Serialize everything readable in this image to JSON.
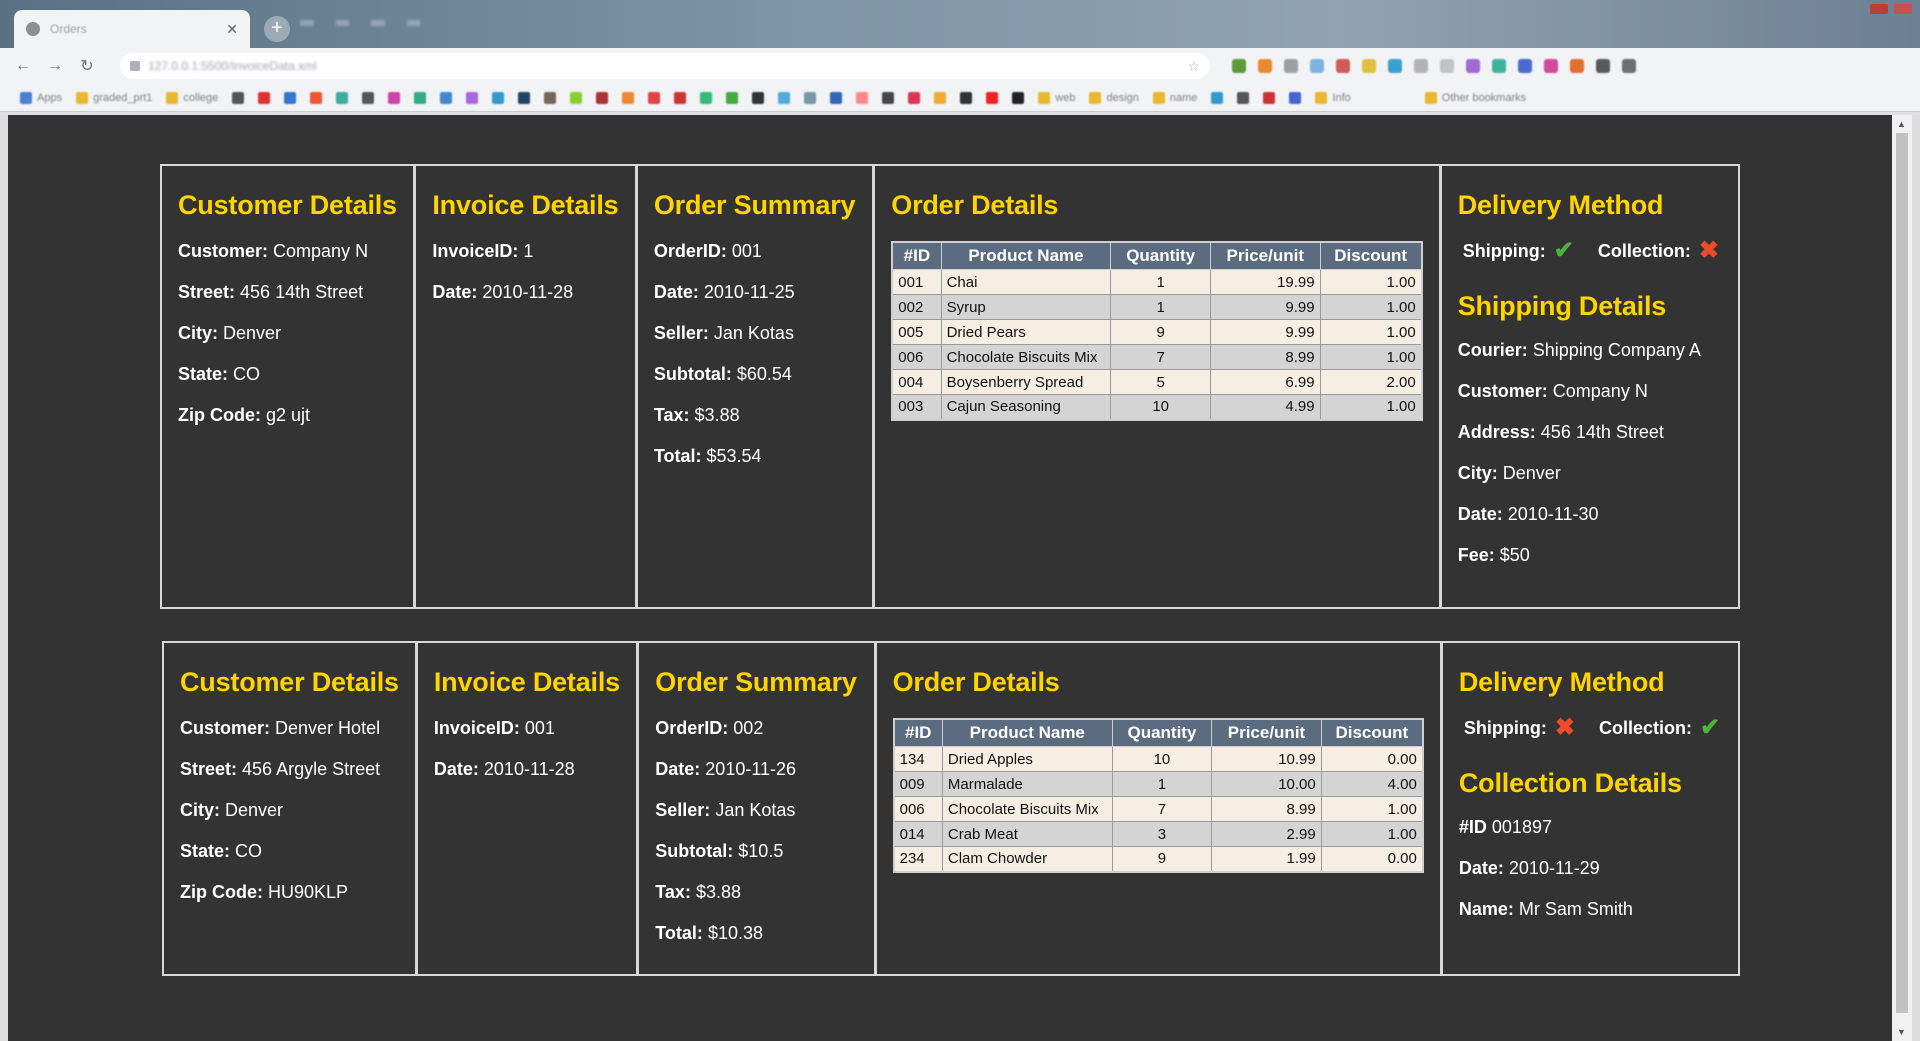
{
  "browser": {
    "tab_title": "Orders",
    "url": "127.0.0.1:5500/InvoiceData.xml",
    "bookmarks": [
      "Apps",
      "graded_prt1",
      "college",
      "web",
      "design",
      "name",
      "Info",
      "Other bookmarks"
    ]
  },
  "orders": [
    {
      "customer": {
        "title": "Customer Details",
        "customer_label": "Customer:",
        "customer": "Company N",
        "street_label": "Street:",
        "street": "456 14th Street",
        "city_label": "City:",
        "city": "Denver",
        "state_label": "State:",
        "state": "CO",
        "zip_label": "Zip Code:",
        "zip": "g2 ujt"
      },
      "invoice": {
        "title": "Invoice Details",
        "id_label": "InvoiceID:",
        "id": "1",
        "date_label": "Date:",
        "date": "2010-11-28"
      },
      "summary": {
        "title": "Order Summary",
        "order_label": "OrderID:",
        "order": "001",
        "date_label": "Date:",
        "date": "2010-11-25",
        "seller_label": "Seller:",
        "seller": "Jan Kotas",
        "subtotal_label": "Subtotal:",
        "subtotal": "$60.54",
        "tax_label": "Tax:",
        "tax": "$3.88",
        "total_label": "Total:",
        "total": "$53.54"
      },
      "details": {
        "title": "Order Details",
        "columns": [
          "#ID",
          "Product Name",
          "Quantity",
          "Price/unit",
          "Discount"
        ],
        "rows": [
          [
            "001",
            "Chai",
            "1",
            "19.99",
            "1.00"
          ],
          [
            "002",
            "Syrup",
            "1",
            "9.99",
            "1.00"
          ],
          [
            "005",
            "Dried Pears",
            "9",
            "9.99",
            "1.00"
          ],
          [
            "006",
            "Chocolate Biscuits Mix",
            "7",
            "8.99",
            "1.00"
          ],
          [
            "004",
            "Boysenberry Spread",
            "5",
            "6.99",
            "2.00"
          ],
          [
            "003",
            "Cajun Seasoning",
            "10",
            "4.99",
            "1.00"
          ]
        ]
      },
      "delivery": {
        "title": "Delivery Method",
        "shipping_label": "Shipping:",
        "shipping_icon": "check-icon",
        "collection_label": "Collection:",
        "collection_icon": "cross-icon",
        "sub_title": "Shipping Details",
        "courier_label": "Courier:",
        "courier": "Shipping Company A",
        "customer_label": "Customer:",
        "customer": "Company N",
        "address_label": "Address:",
        "address": "456 14th Street",
        "city_label": "City:",
        "city": "Denver",
        "date_label": "Date:",
        "date": "2010-11-30",
        "fee_label": "Fee:",
        "fee": "$50"
      }
    },
    {
      "customer": {
        "title": "Customer Details",
        "customer_label": "Customer:",
        "customer": "Denver Hotel",
        "street_label": "Street:",
        "street": "456 Argyle Street",
        "city_label": "City:",
        "city": "Denver",
        "state_label": "State:",
        "state": "CO",
        "zip_label": "Zip Code:",
        "zip": "HU90KLP"
      },
      "invoice": {
        "title": "Invoice Details",
        "id_label": "InvoiceID:",
        "id": "001",
        "date_label": "Date:",
        "date": "2010-11-28"
      },
      "summary": {
        "title": "Order Summary",
        "order_label": "OrderID:",
        "order": "002",
        "date_label": "Date:",
        "date": "2010-11-26",
        "seller_label": "Seller:",
        "seller": "Jan Kotas",
        "subtotal_label": "Subtotal:",
        "subtotal": "$10.5",
        "tax_label": "Tax:",
        "tax": "$3.88",
        "total_label": "Total:",
        "total": "$10.38"
      },
      "details": {
        "title": "Order Details",
        "columns": [
          "#ID",
          "Product Name",
          "Quantity",
          "Price/unit",
          "Discount"
        ],
        "rows": [
          [
            "134",
            "Dried Apples",
            "10",
            "10.99",
            "0.00"
          ],
          [
            "009",
            "Marmalade",
            "1",
            "10.00",
            "4.00"
          ],
          [
            "006",
            "Chocolate Biscuits Mix",
            "7",
            "8.99",
            "1.00"
          ],
          [
            "014",
            "Crab Meat",
            "3",
            "2.99",
            "1.00"
          ],
          [
            "234",
            "Clam Chowder",
            "9",
            "1.99",
            "0.00"
          ]
        ]
      },
      "delivery": {
        "title": "Delivery Method",
        "shipping_label": "Shipping:",
        "shipping_icon": "cross-icon",
        "collection_label": "Collection:",
        "collection_icon": "check-icon",
        "sub_title": "Collection Details",
        "collid_label": "#ID",
        "collid": "001897",
        "date_label": "Date:",
        "date": "2010-11-29",
        "name_label": "Name:",
        "name": "Mr Sam Smith"
      }
    }
  ],
  "colors": {
    "page_bg": "#333333",
    "heading": "#ffd400",
    "table_header": "#5b6b80",
    "check": "#4db33d",
    "cross": "#ef4a2a"
  }
}
